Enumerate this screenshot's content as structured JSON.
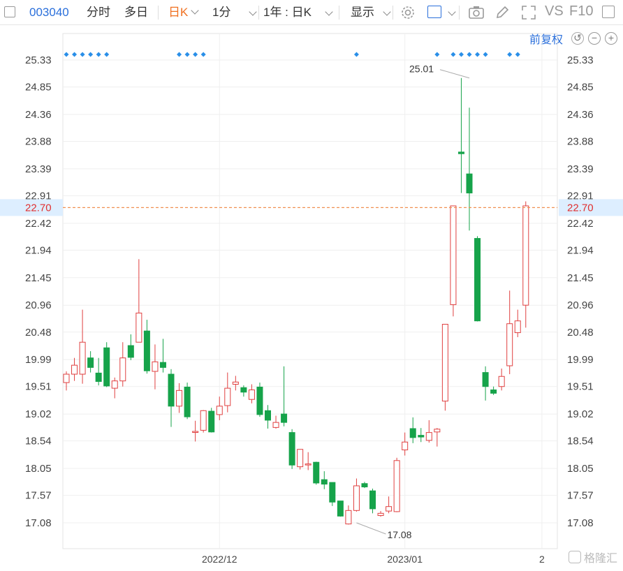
{
  "toolbar": {
    "code": "003040",
    "tab_intraday": "分时",
    "tab_multiday": "多日",
    "tab_dayk": "日K",
    "tab_min": "1分",
    "range": "1年 : 日K",
    "display": "显示",
    "vs": "VS",
    "f10": "F10"
  },
  "adjust": {
    "label": "前复权"
  },
  "colors": {
    "up": "#e04040",
    "down": "#16a34a",
    "accent": "#2a6fdb",
    "active": "#f07020",
    "current": "#e03030"
  },
  "watermark": "格隆汇",
  "chart_data": {
    "type": "candlestick",
    "y_ticks": [
      "25.33",
      "24.85",
      "24.36",
      "23.88",
      "23.39",
      "22.91",
      "22.42",
      "21.94",
      "21.45",
      "20.96",
      "20.48",
      "19.99",
      "19.51",
      "19.02",
      "18.54",
      "18.05",
      "17.57",
      "17.08"
    ],
    "ylim": [
      16.6,
      25.5
    ],
    "x_ticks": [
      {
        "label": "2022/12",
        "index": 19
      },
      {
        "label": "2023/01",
        "index": 42
      },
      {
        "label": "2",
        "index": 59
      }
    ],
    "current_price": {
      "value": "22.70"
    },
    "max_label": {
      "value": "25.01",
      "index": 50
    },
    "min_label": {
      "value": "17.08",
      "index": 36
    },
    "event_marker_indices": [
      0,
      1,
      2,
      3,
      4,
      5,
      14,
      15,
      16,
      17,
      36,
      46,
      48,
      49,
      50,
      51,
      52,
      55,
      56
    ],
    "candles": [
      {
        "o": 19.58,
        "c": 19.73,
        "h": 19.78,
        "l": 19.44
      },
      {
        "o": 19.73,
        "c": 19.89,
        "h": 20.02,
        "l": 19.61
      },
      {
        "o": 19.73,
        "c": 20.3,
        "h": 20.88,
        "l": 19.56
      },
      {
        "o": 20.02,
        "c": 19.85,
        "h": 20.14,
        "l": 19.76
      },
      {
        "o": 19.75,
        "c": 19.6,
        "h": 20.02,
        "l": 19.53
      },
      {
        "o": 20.2,
        "c": 19.52,
        "h": 20.3,
        "l": 19.5
      },
      {
        "o": 19.48,
        "c": 19.61,
        "h": 19.67,
        "l": 19.3
      },
      {
        "o": 19.61,
        "c": 20.02,
        "h": 20.3,
        "l": 19.51
      },
      {
        "o": 20.24,
        "c": 20.03,
        "h": 20.44,
        "l": 19.98
      },
      {
        "o": 20.3,
        "c": 20.82,
        "h": 21.78,
        "l": 20.3
      },
      {
        "o": 20.5,
        "c": 19.79,
        "h": 20.7,
        "l": 19.74
      },
      {
        "o": 19.78,
        "c": 19.95,
        "h": 20.26,
        "l": 19.46
      },
      {
        "o": 19.94,
        "c": 19.85,
        "h": 20.36,
        "l": 19.76
      },
      {
        "o": 19.73,
        "c": 19.16,
        "h": 19.82,
        "l": 18.79
      },
      {
        "o": 19.16,
        "c": 19.44,
        "h": 19.57,
        "l": 19.04
      },
      {
        "o": 19.5,
        "c": 18.97,
        "h": 19.58,
        "l": 18.93
      },
      {
        "o": 18.71,
        "c": 18.71,
        "h": 18.9,
        "l": 18.53
      },
      {
        "o": 18.73,
        "c": 19.08,
        "h": 19.09,
        "l": 18.69
      },
      {
        "o": 19.07,
        "c": 18.7,
        "h": 19.13,
        "l": 18.69
      },
      {
        "o": 19.01,
        "c": 19.16,
        "h": 19.33,
        "l": 18.91
      },
      {
        "o": 19.17,
        "c": 19.48,
        "h": 19.76,
        "l": 19.05
      },
      {
        "o": 19.55,
        "c": 19.59,
        "h": 19.7,
        "l": 19.44
      },
      {
        "o": 19.49,
        "c": 19.41,
        "h": 19.53,
        "l": 19.33
      },
      {
        "o": 19.28,
        "c": 19.45,
        "h": 19.55,
        "l": 19.21
      },
      {
        "o": 19.5,
        "c": 19.01,
        "h": 19.58,
        "l": 18.97
      },
      {
        "o": 19.08,
        "c": 18.91,
        "h": 19.18,
        "l": 18.76
      },
      {
        "o": 18.78,
        "c": 18.87,
        "h": 18.99,
        "l": 18.76
      },
      {
        "o": 19.02,
        "c": 18.87,
        "h": 19.87,
        "l": 18.8
      },
      {
        "o": 18.69,
        "c": 18.11,
        "h": 18.75,
        "l": 18.04
      },
      {
        "o": 18.08,
        "c": 18.39,
        "h": 18.39,
        "l": 18.03
      },
      {
        "o": 18.13,
        "c": 18.13,
        "h": 18.34,
        "l": 18.02
      },
      {
        "o": 18.16,
        "c": 17.79,
        "h": 18.17,
        "l": 17.76
      },
      {
        "o": 17.85,
        "c": 17.77,
        "h": 18.0,
        "l": 17.68
      },
      {
        "o": 17.8,
        "c": 17.45,
        "h": 17.8,
        "l": 17.38
      },
      {
        "o": 17.47,
        "c": 17.2,
        "h": 17.47,
        "l": 17.19
      },
      {
        "o": 17.06,
        "c": 17.3,
        "h": 17.39,
        "l": 17.05
      },
      {
        "o": 17.3,
        "c": 17.74,
        "h": 17.87,
        "l": 17.28
      },
      {
        "o": 17.78,
        "c": 17.72,
        "h": 17.81,
        "l": 17.7
      },
      {
        "o": 17.65,
        "c": 17.33,
        "h": 17.69,
        "l": 17.25
      },
      {
        "o": 17.21,
        "c": 17.25,
        "h": 17.29,
        "l": 17.19
      },
      {
        "o": 17.29,
        "c": 17.37,
        "h": 17.55,
        "l": 17.25
      },
      {
        "o": 17.28,
        "c": 18.19,
        "h": 18.24,
        "l": 17.27
      },
      {
        "o": 18.38,
        "c": 18.52,
        "h": 18.69,
        "l": 18.28
      },
      {
        "o": 18.76,
        "c": 18.6,
        "h": 18.96,
        "l": 18.5
      },
      {
        "o": 18.64,
        "c": 18.61,
        "h": 18.77,
        "l": 18.52
      },
      {
        "o": 18.55,
        "c": 18.69,
        "h": 18.91,
        "l": 18.51
      },
      {
        "o": 18.7,
        "c": 18.75,
        "h": 18.77,
        "l": 18.44
      },
      {
        "o": 19.25,
        "c": 20.62,
        "h": 20.62,
        "l": 19.08
      },
      {
        "o": 20.97,
        "c": 22.73,
        "h": 22.73,
        "l": 20.76
      },
      {
        "o": 23.69,
        "c": 23.66,
        "h": 25.01,
        "l": 22.96
      },
      {
        "o": 23.3,
        "c": 22.96,
        "h": 24.48,
        "l": 22.29
      },
      {
        "o": 22.15,
        "c": 20.68,
        "h": 22.19,
        "l": 20.67
      },
      {
        "o": 19.76,
        "c": 19.51,
        "h": 19.87,
        "l": 19.26
      },
      {
        "o": 19.45,
        "c": 19.39,
        "h": 19.51,
        "l": 19.36
      },
      {
        "o": 19.51,
        "c": 19.69,
        "h": 19.83,
        "l": 19.44
      },
      {
        "o": 19.88,
        "c": 20.63,
        "h": 21.22,
        "l": 19.73
      },
      {
        "o": 20.47,
        "c": 20.68,
        "h": 20.88,
        "l": 20.39
      },
      {
        "o": 20.96,
        "c": 22.73,
        "h": 22.81,
        "l": 20.56
      }
    ]
  }
}
